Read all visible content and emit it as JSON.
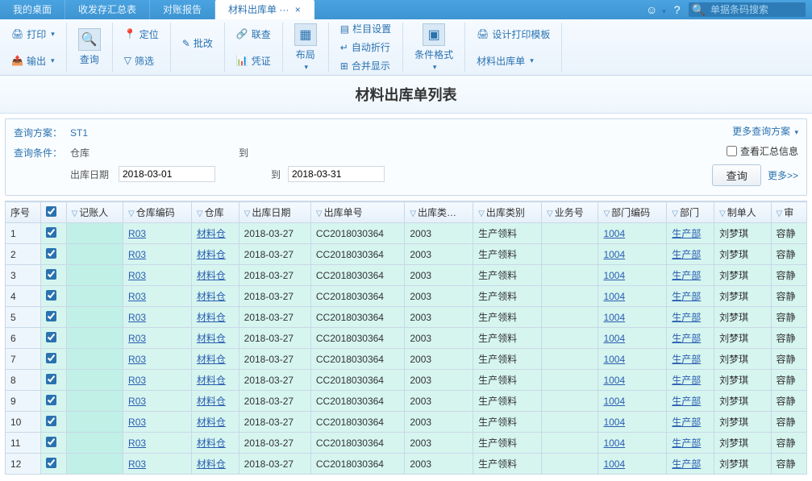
{
  "tabs": {
    "items": [
      "我的桌面",
      "收发存汇总表",
      "对账报告",
      "材料出库单 ···"
    ],
    "activeIndex": 3
  },
  "search_placeholder": "单据条码搜索",
  "toolbar": {
    "print": "打印",
    "output": "输出",
    "query": "查询",
    "locate": "定位",
    "filter": "筛选",
    "batch": "批改",
    "related": "联查",
    "voucher": "凭证",
    "layout": "布局",
    "col_setting": "栏目设置",
    "auto_wrap": "自动折行",
    "merge_show": "合并显示",
    "cond_format": "条件格式",
    "design_print": "设计打印模板",
    "list_name": "材料出库单"
  },
  "page_title": "材料出库单列表",
  "query": {
    "plan_label": "查询方案：",
    "plan_value": "ST1",
    "cond_label": "查询条件：",
    "warehouse_label": "仓库",
    "to": "到",
    "date_label": "出库日期",
    "date_from": "2018-03-01",
    "date_to": "2018-03-31",
    "more_plans": "更多查询方案",
    "show_summary": "查看汇总信息",
    "btn_query": "查询",
    "more": "更多>>"
  },
  "table": {
    "headers": {
      "seq": "序号",
      "poster": "记账人",
      "wh_code": "仓库编码",
      "warehouse": "仓库",
      "out_date": "出库日期",
      "out_no": "出库单号",
      "out_class": "出库类…",
      "out_kind": "出库类别",
      "biz_no": "业务号",
      "dept_code": "部门编码",
      "dept": "部门",
      "creator": "制单人",
      "last": "审"
    },
    "rows": [
      {
        "seq": "1",
        "wh_code": "R03",
        "wh": "材料仓",
        "date": "2018-03-27",
        "no": "CC2018030364",
        "cls": "2003",
        "kind": "生产领料",
        "dcode": "1004",
        "dept": "生产部",
        "cr": "刘梦琪",
        "ex": "容静"
      },
      {
        "seq": "2",
        "wh_code": "R03",
        "wh": "材料仓",
        "date": "2018-03-27",
        "no": "CC2018030364",
        "cls": "2003",
        "kind": "生产领料",
        "dcode": "1004",
        "dept": "生产部",
        "cr": "刘梦琪",
        "ex": "容静"
      },
      {
        "seq": "3",
        "wh_code": "R03",
        "wh": "材料仓",
        "date": "2018-03-27",
        "no": "CC2018030364",
        "cls": "2003",
        "kind": "生产领料",
        "dcode": "1004",
        "dept": "生产部",
        "cr": "刘梦琪",
        "ex": "容静"
      },
      {
        "seq": "4",
        "wh_code": "R03",
        "wh": "材料仓",
        "date": "2018-03-27",
        "no": "CC2018030364",
        "cls": "2003",
        "kind": "生产领料",
        "dcode": "1004",
        "dept": "生产部",
        "cr": "刘梦琪",
        "ex": "容静"
      },
      {
        "seq": "5",
        "wh_code": "R03",
        "wh": "材料仓",
        "date": "2018-03-27",
        "no": "CC2018030364",
        "cls": "2003",
        "kind": "生产领料",
        "dcode": "1004",
        "dept": "生产部",
        "cr": "刘梦琪",
        "ex": "容静"
      },
      {
        "seq": "6",
        "wh_code": "R03",
        "wh": "材料仓",
        "date": "2018-03-27",
        "no": "CC2018030364",
        "cls": "2003",
        "kind": "生产领料",
        "dcode": "1004",
        "dept": "生产部",
        "cr": "刘梦琪",
        "ex": "容静"
      },
      {
        "seq": "7",
        "wh_code": "R03",
        "wh": "材料仓",
        "date": "2018-03-27",
        "no": "CC2018030364",
        "cls": "2003",
        "kind": "生产领料",
        "dcode": "1004",
        "dept": "生产部",
        "cr": "刘梦琪",
        "ex": "容静"
      },
      {
        "seq": "8",
        "wh_code": "R03",
        "wh": "材料仓",
        "date": "2018-03-27",
        "no": "CC2018030364",
        "cls": "2003",
        "kind": "生产领料",
        "dcode": "1004",
        "dept": "生产部",
        "cr": "刘梦琪",
        "ex": "容静"
      },
      {
        "seq": "9",
        "wh_code": "R03",
        "wh": "材料仓",
        "date": "2018-03-27",
        "no": "CC2018030364",
        "cls": "2003",
        "kind": "生产领料",
        "dcode": "1004",
        "dept": "生产部",
        "cr": "刘梦琪",
        "ex": "容静"
      },
      {
        "seq": "10",
        "wh_code": "R03",
        "wh": "材料仓",
        "date": "2018-03-27",
        "no": "CC2018030364",
        "cls": "2003",
        "kind": "生产领料",
        "dcode": "1004",
        "dept": "生产部",
        "cr": "刘梦琪",
        "ex": "容静"
      },
      {
        "seq": "11",
        "wh_code": "R03",
        "wh": "材料仓",
        "date": "2018-03-27",
        "no": "CC2018030364",
        "cls": "2003",
        "kind": "生产领料",
        "dcode": "1004",
        "dept": "生产部",
        "cr": "刘梦琪",
        "ex": "容静"
      },
      {
        "seq": "12",
        "wh_code": "R03",
        "wh": "材料仓",
        "date": "2018-03-27",
        "no": "CC2018030364",
        "cls": "2003",
        "kind": "生产领料",
        "dcode": "1004",
        "dept": "生产部",
        "cr": "刘梦琪",
        "ex": "容静"
      }
    ]
  }
}
